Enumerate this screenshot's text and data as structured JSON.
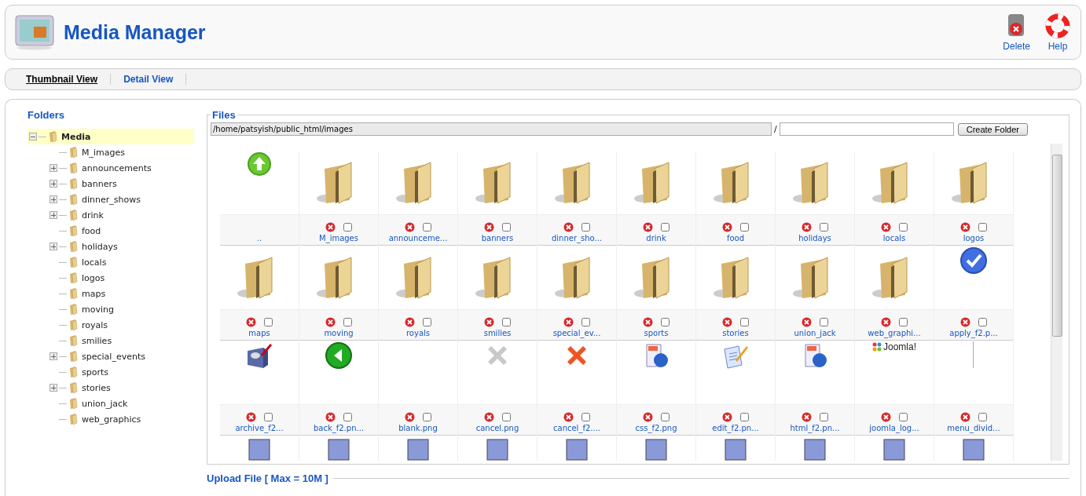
{
  "header": {
    "title": "Media Manager",
    "actions": [
      {
        "kind": "delete",
        "label": "Delete"
      },
      {
        "kind": "help",
        "label": "Help"
      }
    ]
  },
  "tabs": [
    {
      "label": "Thumbnail View",
      "selected": true
    },
    {
      "label": "Detail View",
      "selected": false
    }
  ],
  "folders": {
    "title": "Folders",
    "tree": [
      {
        "name": "Media",
        "selected": true,
        "expanded": true,
        "children": [
          {
            "name": "M_images",
            "has_children": false
          },
          {
            "name": "announcements",
            "has_children": true
          },
          {
            "name": "banners",
            "has_children": true
          },
          {
            "name": "dinner_shows",
            "has_children": true
          },
          {
            "name": "drink",
            "has_children": true
          },
          {
            "name": "food",
            "has_children": false
          },
          {
            "name": "holidays",
            "has_children": true
          },
          {
            "name": "locals",
            "has_children": false
          },
          {
            "name": "logos",
            "has_children": false
          },
          {
            "name": "maps",
            "has_children": false
          },
          {
            "name": "moving",
            "has_children": false
          },
          {
            "name": "royals",
            "has_children": false
          },
          {
            "name": "smilies",
            "has_children": false
          },
          {
            "name": "special_events",
            "has_children": true
          },
          {
            "name": "sports",
            "has_children": false
          },
          {
            "name": "stories",
            "has_children": true
          },
          {
            "name": "union_jack",
            "has_children": false
          },
          {
            "name": "web_graphics",
            "has_children": false
          }
        ]
      }
    ]
  },
  "files": {
    "title": "Files",
    "path": "/home/patsyish/public_html/images",
    "separator": "/",
    "create_button": "Create Folder",
    "items": [
      {
        "kind": "up",
        "name": ".."
      },
      {
        "kind": "folder",
        "name": "M_images",
        "checked": false
      },
      {
        "kind": "folder",
        "name": "announceme...",
        "checked": false
      },
      {
        "kind": "folder",
        "name": "banners",
        "checked": false
      },
      {
        "kind": "folder",
        "name": "dinner_sho...",
        "checked": false
      },
      {
        "kind": "folder",
        "name": "drink",
        "checked": false
      },
      {
        "kind": "folder",
        "name": "food",
        "checked": false
      },
      {
        "kind": "folder",
        "name": "holidays",
        "checked": false
      },
      {
        "kind": "folder",
        "name": "locals",
        "checked": false
      },
      {
        "kind": "folder",
        "name": "logos",
        "checked": false
      },
      {
        "kind": "folder",
        "name": "maps",
        "checked": false
      },
      {
        "kind": "folder",
        "name": "moving",
        "checked": false
      },
      {
        "kind": "folder",
        "name": "royals",
        "checked": false
      },
      {
        "kind": "folder",
        "name": "smilies",
        "checked": false
      },
      {
        "kind": "folder",
        "name": "special_ev...",
        "checked": false
      },
      {
        "kind": "folder",
        "name": "sports",
        "checked": false
      },
      {
        "kind": "folder",
        "name": "stories",
        "checked": false
      },
      {
        "kind": "folder",
        "name": "union_jack",
        "checked": false
      },
      {
        "kind": "folder",
        "name": "web_graphi...",
        "checked": false
      },
      {
        "kind": "check",
        "name": "apply_f2.p...",
        "checked": false
      },
      {
        "kind": "archive",
        "name": "archive_f2...",
        "checked": false
      },
      {
        "kind": "back",
        "name": "back_f2.pn...",
        "checked": false
      },
      {
        "kind": "blank",
        "name": "blank.png",
        "checked": false
      },
      {
        "kind": "cancel-grey",
        "name": "cancel.png",
        "checked": false
      },
      {
        "kind": "cancel",
        "name": "cancel_f2....",
        "checked": false
      },
      {
        "kind": "web",
        "name": "css_f2.png",
        "checked": false
      },
      {
        "kind": "edit",
        "name": "edit_f2.pn...",
        "checked": false
      },
      {
        "kind": "web",
        "name": "html_f2.pn...",
        "checked": false
      },
      {
        "kind": "logo",
        "name": "joomla_log...",
        "logo_text": "Joomla!",
        "checked": false
      },
      {
        "kind": "divider",
        "name": "menu_divid...",
        "checked": false
      },
      {
        "kind": "file"
      },
      {
        "kind": "file"
      },
      {
        "kind": "file"
      },
      {
        "kind": "file"
      },
      {
        "kind": "file"
      },
      {
        "kind": "file"
      },
      {
        "kind": "file"
      },
      {
        "kind": "file"
      },
      {
        "kind": "file"
      },
      {
        "kind": "file"
      }
    ]
  },
  "upload": {
    "title": "Upload File [ Max = 10M ]"
  }
}
